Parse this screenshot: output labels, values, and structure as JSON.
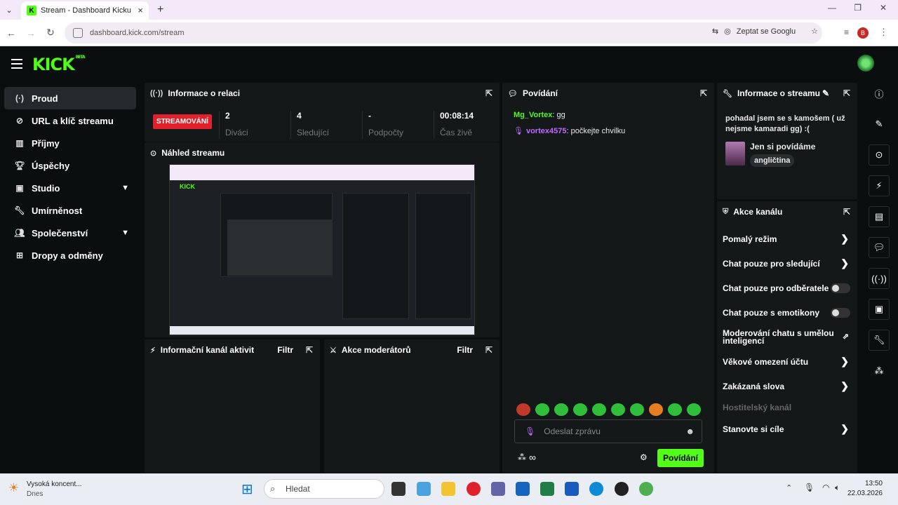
{
  "browser": {
    "tab_title": "Stream - Dashboard Kicku",
    "url": "dashboard.kick.com/stream",
    "ask_google": "Zeptat se Googlu",
    "profile_letter": "B"
  },
  "logo": {
    "text": "KICK",
    "beta": "BETA"
  },
  "sidebar": {
    "items": [
      {
        "label": "Proud",
        "icon": "stream-icon"
      },
      {
        "label": "URL a klíč streamu",
        "icon": "link-icon"
      },
      {
        "label": "Příjmy",
        "icon": "bar-chart-icon"
      },
      {
        "label": "Úspěchy",
        "icon": "trophy-icon"
      },
      {
        "label": "Studio",
        "icon": "studio-icon"
      },
      {
        "label": "Umírněnost",
        "icon": "wrench-icon"
      },
      {
        "label": "Společenství",
        "icon": "community-icon"
      },
      {
        "label": "Dropy a odměny",
        "icon": "drops-icon"
      }
    ]
  },
  "session": {
    "title": "Informace o relaci",
    "status": "STREAMOVÁNÍ",
    "stats": [
      {
        "value": "2",
        "label": "Diváci"
      },
      {
        "value": "4",
        "label": "Sledující"
      },
      {
        "value": "-",
        "label": "Podpočty"
      },
      {
        "value": "00:08:14",
        "label": "Čas živě"
      }
    ]
  },
  "preview": {
    "title": "Náhled streamu"
  },
  "activity": {
    "title": "Informační kanál aktivit",
    "filter": "Filtr"
  },
  "modactions": {
    "title": "Akce moderátorů",
    "filter": "Filtr"
  },
  "chat": {
    "title": "Povídání",
    "messages": [
      {
        "user": "Mg_Vortex",
        "text": ": gg"
      },
      {
        "user": "vortex4575",
        "text": ": počkejte chvilku"
      }
    ],
    "input_placeholder": "Odeslat zprávu",
    "infinity": "∞",
    "send_label": "Povídání"
  },
  "streaminfo": {
    "title": "Informace o streamu",
    "stream_title": "pohadal jsem se s kamošem ( už nejsme kamaradi gg) :(",
    "category": "Jen si povídáme",
    "language": "angličtina"
  },
  "channel_actions": {
    "title": "Akce kanálu",
    "items": [
      {
        "label": "Pomalý režim",
        "kind": "arrow"
      },
      {
        "label": "Chat pouze pro sledující",
        "kind": "arrow"
      },
      {
        "label": "Chat pouze pro odběratele",
        "kind": "toggle",
        "enabled": false
      },
      {
        "label": "Chat pouze s emotikony",
        "kind": "toggle",
        "enabled": false
      },
      {
        "label": "Moderování chatu s umělou inteligencí",
        "kind": "external"
      },
      {
        "label": "Věkové omezení účtu",
        "kind": "arrow"
      },
      {
        "label": "Zakázaná slova",
        "kind": "arrow"
      },
      {
        "label": "Hostitelský kanál",
        "kind": "disabled"
      },
      {
        "label": "Stanovte si cíle",
        "kind": "arrow"
      }
    ]
  },
  "taskbar": {
    "weather_title": "Vysoká koncent...",
    "weather_sub": "Dnes",
    "search": "Hledat",
    "time": "13:50",
    "date": "22.03.2026"
  },
  "colors": {
    "accent": "#53fc18",
    "live": "#e0202a",
    "chat_user1": "#53fc18",
    "chat_user2": "#c069ff"
  }
}
